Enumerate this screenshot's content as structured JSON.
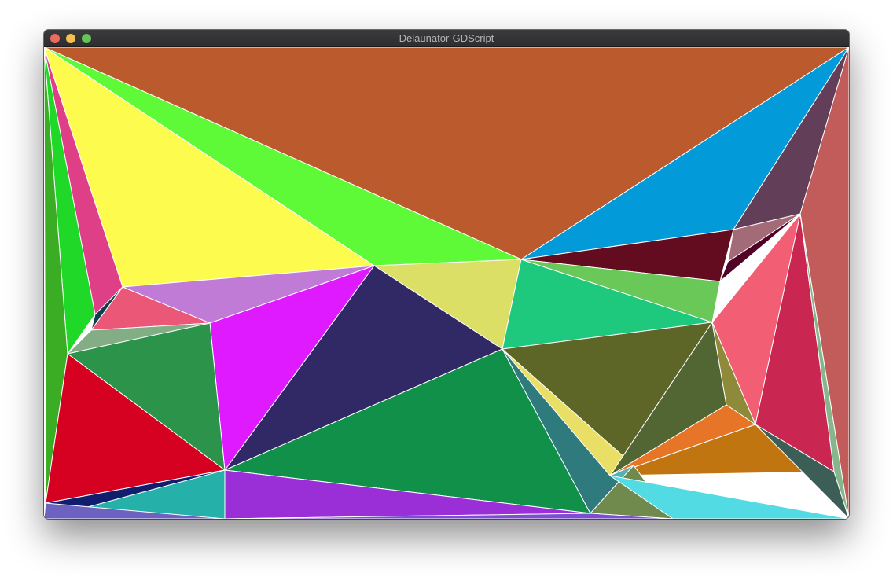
{
  "window": {
    "title": "Delaunator-GDScript",
    "controls": {
      "close_color": "#ed6a5e",
      "minimize_color": "#f5bf4f",
      "zoom_color": "#62c554"
    }
  },
  "canvas": {
    "background": "#ffffff",
    "edge_color": "#ffffff",
    "triangle_colors": [
      "#bb5b2d",
      "#039ad9",
      "#5ffa37",
      "#fdfb4e",
      "#623e58",
      "#c15c5a",
      "#df3f86",
      "#20d827",
      "#3aad24",
      "#a36b78",
      "#630b1f",
      "#510226",
      "#dbdf66",
      "#1ec97e",
      "#6ac858",
      "#f25e73",
      "#c92752",
      "#bf7bd6",
      "#312966",
      "#e01aff",
      "#eb5777",
      "#0d3f4f",
      "#82ad85",
      "#2c944a",
      "#d60021",
      "#11904a",
      "#5d6627",
      "#2e7a7c",
      "#e9df66",
      "#526634",
      "#8e8a39",
      "#e67527",
      "#c07511",
      "#3d5e56",
      "#86b78c",
      "#55b0b2",
      "#708a4e",
      "#53dbe3",
      "#7040d6",
      "#9a2fd8",
      "#111e6e",
      "#25b0a9",
      "#7c4fd0",
      "#3d9f8a",
      "#6d62c0"
    ]
  }
}
